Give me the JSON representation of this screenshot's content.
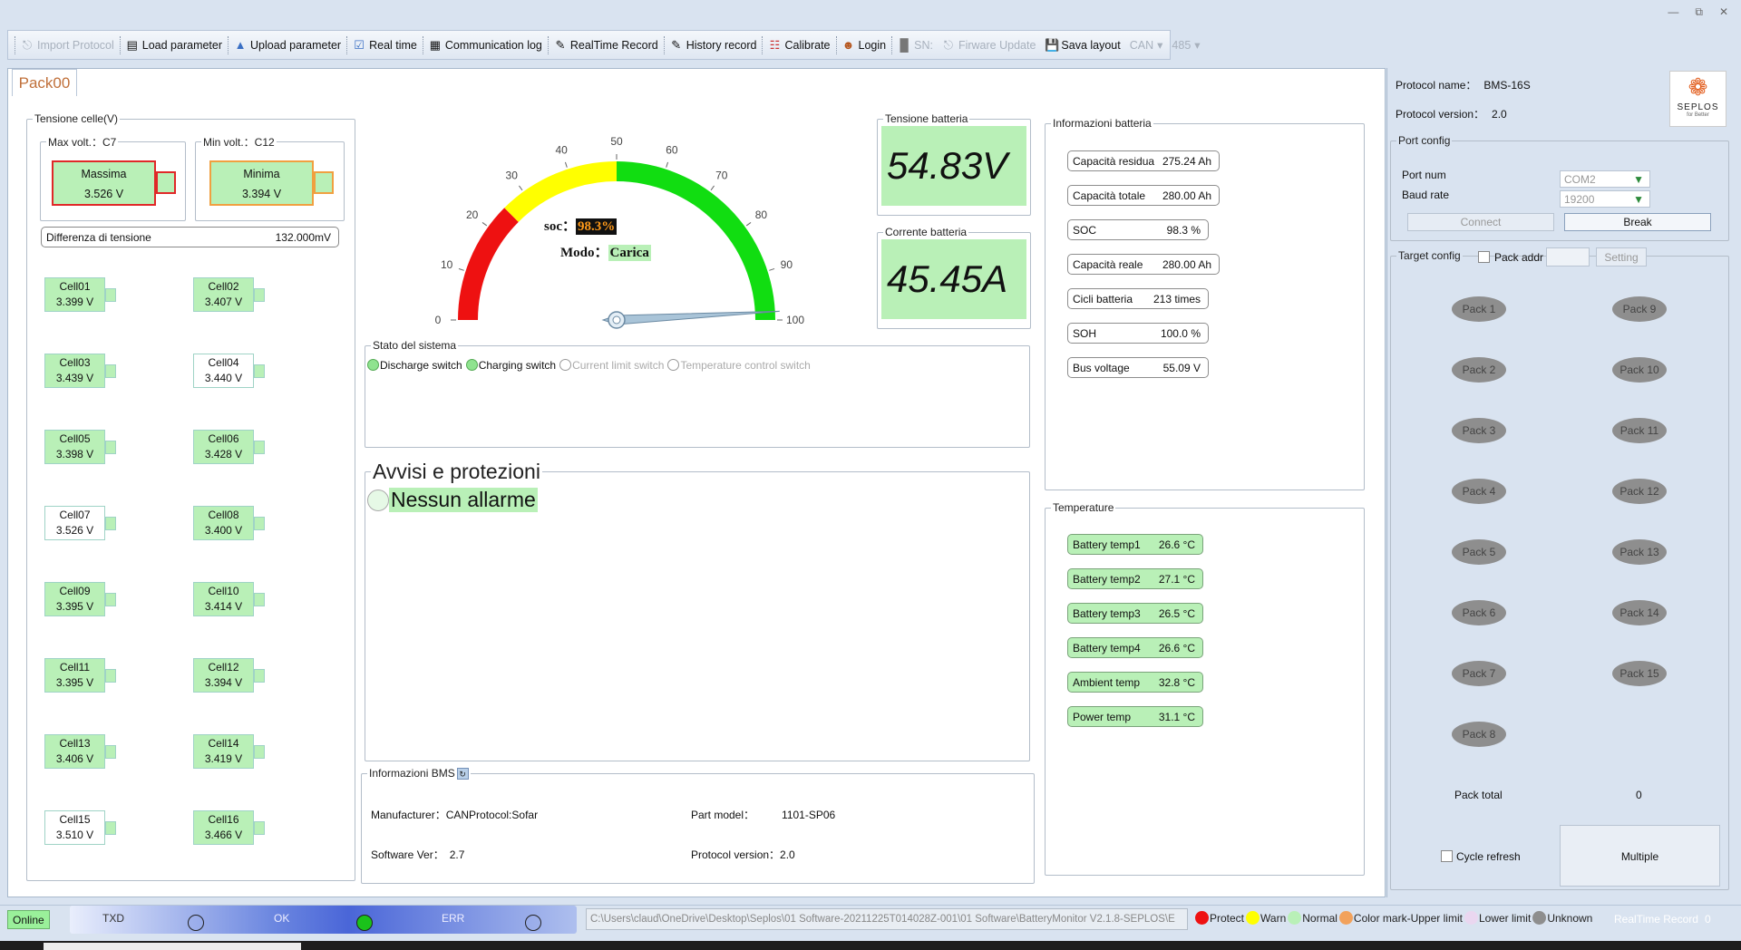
{
  "toolbar": {
    "import_protocol": "Import Protocol",
    "load_parameter": "Load parameter",
    "upload_parameter": "Upload parameter",
    "real_time": "Real time",
    "communication_log": "Communication log",
    "realtime_record": "RealTime Record",
    "history_record": "History record",
    "calibrate": "Calibrate",
    "login": "Login",
    "sn": "SN:",
    "firmware_update": "Firware Update",
    "save_layout": "Sava layout",
    "can": "CAN",
    "rs485": "485"
  },
  "tab": {
    "label": "Pack00"
  },
  "cells_panel": {
    "title": "Tensione celle(V)",
    "max_title": "Max volt.：C7",
    "max_label": "Massima",
    "max_value": "3.526 V",
    "min_title": "Min volt.：C12",
    "min_label": "Minima",
    "min_value": "3.394 V",
    "diff_label": "Differenza di tensione",
    "diff_value": "132.000mV",
    "cells": [
      {
        "name": "Cell01",
        "value": "3.399 V"
      },
      {
        "name": "Cell02",
        "value": "3.407 V"
      },
      {
        "name": "Cell03",
        "value": "3.439 V"
      },
      {
        "name": "Cell04",
        "value": "3.440 V"
      },
      {
        "name": "Cell05",
        "value": "3.398 V"
      },
      {
        "name": "Cell06",
        "value": "3.428 V"
      },
      {
        "name": "Cell07",
        "value": "3.526 V"
      },
      {
        "name": "Cell08",
        "value": "3.400 V"
      },
      {
        "name": "Cell09",
        "value": "3.395 V"
      },
      {
        "name": "Cell10",
        "value": "3.414 V"
      },
      {
        "name": "Cell11",
        "value": "3.395 V"
      },
      {
        "name": "Cell12",
        "value": "3.394 V"
      },
      {
        "name": "Cell13",
        "value": "3.406 V"
      },
      {
        "name": "Cell14",
        "value": "3.419 V"
      },
      {
        "name": "Cell15",
        "value": "3.510 V"
      },
      {
        "name": "Cell16",
        "value": "3.466 V"
      }
    ]
  },
  "gauge": {
    "ticks": [
      "0",
      "10",
      "20",
      "30",
      "40",
      "50",
      "60",
      "70",
      "80",
      "90",
      "100"
    ],
    "soc_label": "soc：",
    "soc_value": "98.3%",
    "soc_level": 98.3,
    "mode_label": "Modo：",
    "mode_value": "Carica",
    "colors": {
      "red": "#ee1111",
      "yellow": "#ffff00",
      "green": "#11dd11"
    }
  },
  "battery_voltage": {
    "title": "Tensione batteria",
    "value": "54.83V"
  },
  "battery_current": {
    "title": "Corrente batteria",
    "value": "45.45A"
  },
  "system_status": {
    "title": "Stato del sistema",
    "items": [
      "Discharge switch",
      "Charging switch",
      "Current limit switch",
      "Temperature control switch"
    ]
  },
  "alarms": {
    "title": "Avvisi e protezioni",
    "message": "Nessun allarme"
  },
  "bms_info": {
    "title": "Informazioni BMS",
    "manufacturer_label": "Manufacturer：",
    "manufacturer_value": "CANProtocol:Sofar",
    "part_model_label": "Part model：",
    "part_model_value": "1101-SP06",
    "software_label": "Software Ver：",
    "software_value": "2.7",
    "protocol_label": "Protocol version：",
    "protocol_value": "2.0"
  },
  "battery_info": {
    "title": "Informazioni batteria",
    "items": [
      {
        "label": "Capacità residua",
        "value": "275.24 Ah"
      },
      {
        "label": "Capacità totale",
        "value": "280.00 Ah"
      },
      {
        "label": "SOC",
        "value": "98.3 %"
      },
      {
        "label": "Capacità reale",
        "value": "280.00 Ah"
      },
      {
        "label": "Cicli batteria",
        "value": "213 times"
      },
      {
        "label": "SOH",
        "value": "100.0 %"
      },
      {
        "label": "Bus voltage",
        "value": "55.09 V"
      }
    ]
  },
  "temperatures": {
    "title": "Temperature",
    "items": [
      {
        "label": "Battery temp1",
        "value": "26.6 °C"
      },
      {
        "label": "Battery temp2",
        "value": "27.1 °C"
      },
      {
        "label": "Battery temp3",
        "value": "26.5 °C"
      },
      {
        "label": "Battery temp4",
        "value": "26.6 °C"
      },
      {
        "label": "Ambient temp",
        "value": "32.8 °C"
      },
      {
        "label": "Power temp",
        "value": "31.1 °C"
      }
    ]
  },
  "right_panel": {
    "protocol_name_label": "Protocol name：",
    "protocol_name_value": "BMS-16S",
    "protocol_version_label": "Protocol version：",
    "protocol_version_value": "2.0",
    "logo_text": "SEPLOS",
    "logo_sub": "for Better",
    "port_config_title": "Port config",
    "port_num_label": "Port num",
    "port_num_value": "COM2",
    "baud_rate_label": "Baud rate",
    "baud_rate_value": "19200",
    "connect_label": "Connect",
    "break_label": "Break",
    "target_config_title": "Target config",
    "pack_addr_label": "Pack addr",
    "setting_label": "Setting",
    "packs": [
      "Pack 1",
      "Pack 2",
      "Pack 3",
      "Pack 4",
      "Pack 5",
      "Pack 6",
      "Pack 7",
      "Pack 8",
      "Pack 9",
      "Pack 10",
      "Pack 11",
      "Pack 12",
      "Pack 13",
      "Pack 14",
      "Pack 15"
    ],
    "pack_total_label": "Pack total",
    "pack_total_value": "0",
    "cycle_refresh_label": "Cycle refresh",
    "multiple_label": "Multiple"
  },
  "status_bar": {
    "online": "Online",
    "txd": "TXD",
    "ok": "OK",
    "err": "ERR",
    "path": "C:\\Users\\claud\\OneDrive\\Desktop\\Seplos\\01 Software-20211225T014028Z-001\\01 Software\\BatteryMonitor V2.1.8-SEPLOS\\E",
    "legend": [
      {
        "label": "Protect",
        "color": "#ee1111"
      },
      {
        "label": "Warn",
        "color": "#ffff00"
      },
      {
        "label": "Normal",
        "color": "#b9f0b7"
      },
      {
        "label": "Color mark-Upper limit",
        "color": "#f2a25c"
      },
      {
        "label": "Lower limit",
        "color": "#ead7f0"
      },
      {
        "label": "Unknown",
        "color": "#8e8e8e"
      }
    ],
    "realtime_record": "RealTime Record",
    "count": "0"
  }
}
